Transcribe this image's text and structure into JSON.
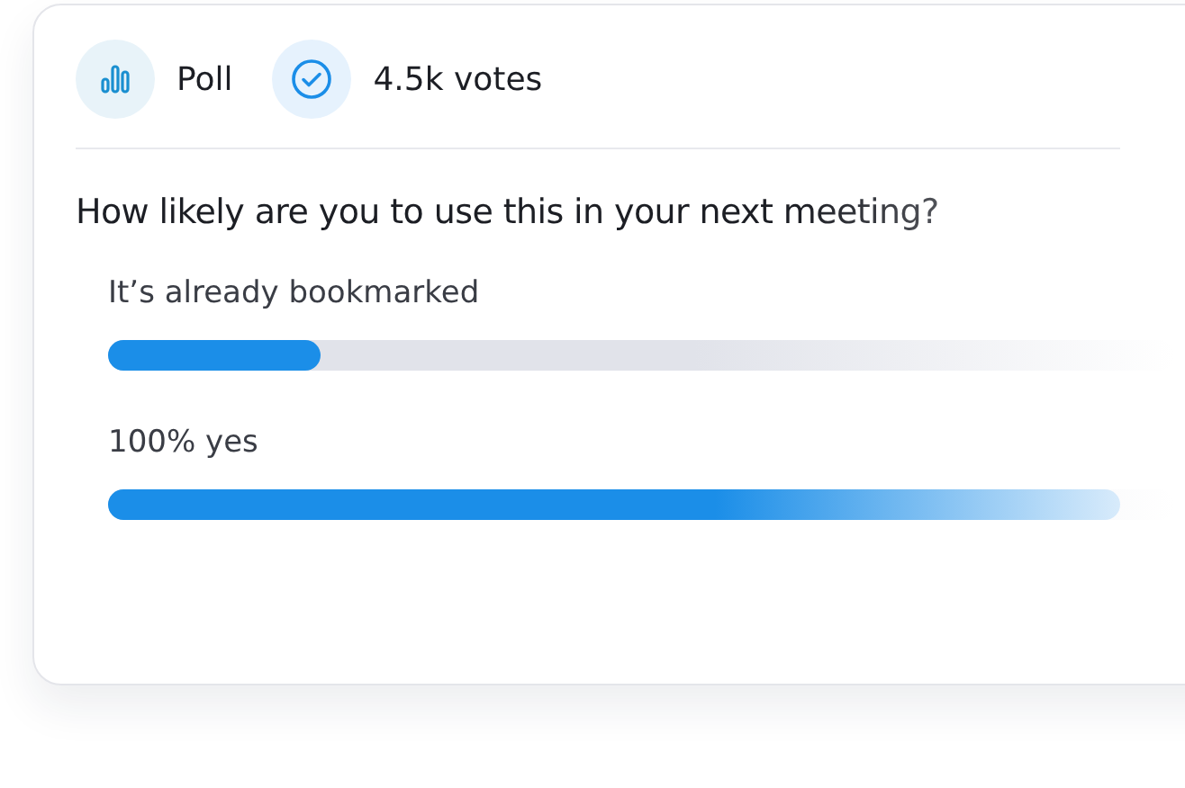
{
  "header": {
    "type_label": "Poll",
    "votes": "4.5k votes"
  },
  "question": "How likely are you to use this in your next meeting?",
  "options": [
    {
      "label": "It’s already bookmarked",
      "level": 0.2
    },
    {
      "label": "100% yes",
      "level": 0.95
    }
  ]
}
